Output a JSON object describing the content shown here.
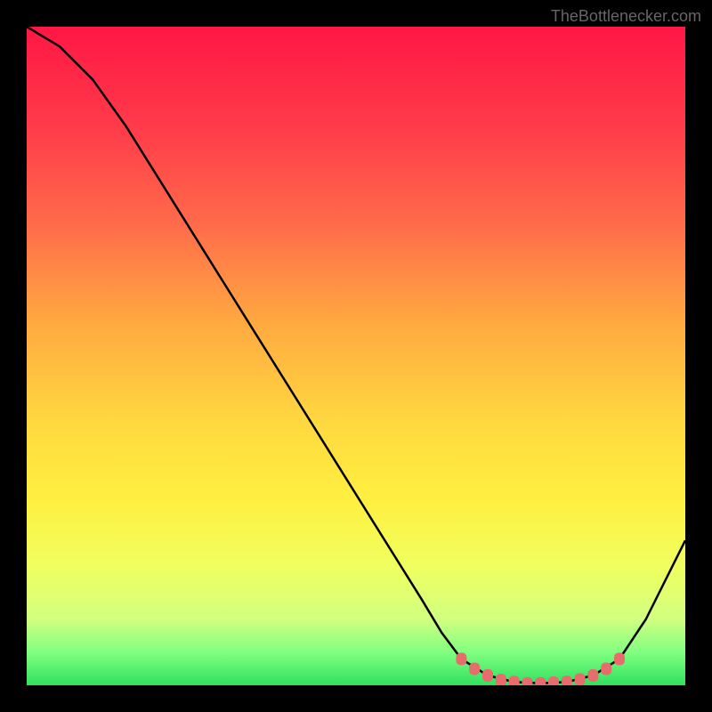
{
  "watermark": "TheBottlenecker.com",
  "chart_data": {
    "type": "line",
    "title": "",
    "xlabel": "",
    "ylabel": "",
    "xlim": [
      0,
      100
    ],
    "ylim": [
      0,
      100
    ],
    "background_gradient": {
      "stops": [
        {
          "offset": 0,
          "color": "#ff1744"
        },
        {
          "offset": 15,
          "color": "#ff3a4a"
        },
        {
          "offset": 30,
          "color": "#ff6b4a"
        },
        {
          "offset": 45,
          "color": "#ffa940"
        },
        {
          "offset": 60,
          "color": "#ffd840"
        },
        {
          "offset": 72,
          "color": "#fff040"
        },
        {
          "offset": 82,
          "color": "#f0ff60"
        },
        {
          "offset": 90,
          "color": "#d0ff80"
        },
        {
          "offset": 95,
          "color": "#80ff80"
        },
        {
          "offset": 100,
          "color": "#30e060"
        }
      ]
    },
    "curve_points": [
      {
        "x": 0,
        "y": 100
      },
      {
        "x": 5,
        "y": 97
      },
      {
        "x": 10,
        "y": 92
      },
      {
        "x": 15,
        "y": 85
      },
      {
        "x": 20,
        "y": 77
      },
      {
        "x": 25,
        "y": 69
      },
      {
        "x": 30,
        "y": 61
      },
      {
        "x": 35,
        "y": 53
      },
      {
        "x": 40,
        "y": 45
      },
      {
        "x": 45,
        "y": 37
      },
      {
        "x": 50,
        "y": 29
      },
      {
        "x": 55,
        "y": 21
      },
      {
        "x": 60,
        "y": 13
      },
      {
        "x": 63,
        "y": 8
      },
      {
        "x": 66,
        "y": 4
      },
      {
        "x": 70,
        "y": 1.5
      },
      {
        "x": 74,
        "y": 0.5
      },
      {
        "x": 78,
        "y": 0.3
      },
      {
        "x": 82,
        "y": 0.5
      },
      {
        "x": 86,
        "y": 1.5
      },
      {
        "x": 90,
        "y": 4
      },
      {
        "x": 94,
        "y": 10
      },
      {
        "x": 98,
        "y": 18
      },
      {
        "x": 100,
        "y": 22
      }
    ],
    "marker_points": [
      {
        "x": 66,
        "y": 4
      },
      {
        "x": 68,
        "y": 2.5
      },
      {
        "x": 70,
        "y": 1.5
      },
      {
        "x": 72,
        "y": 0.8
      },
      {
        "x": 74,
        "y": 0.5
      },
      {
        "x": 76,
        "y": 0.3
      },
      {
        "x": 78,
        "y": 0.3
      },
      {
        "x": 80,
        "y": 0.4
      },
      {
        "x": 82,
        "y": 0.5
      },
      {
        "x": 84,
        "y": 0.9
      },
      {
        "x": 86,
        "y": 1.5
      },
      {
        "x": 88,
        "y": 2.5
      },
      {
        "x": 90,
        "y": 4
      }
    ],
    "marker_color": "#e86c6c",
    "curve_color": "#000000"
  }
}
